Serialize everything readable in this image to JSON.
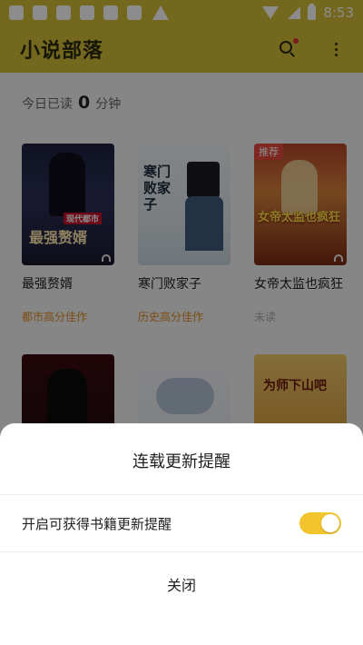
{
  "status_bar": {
    "time": "8:53"
  },
  "app": {
    "title": "小说部落"
  },
  "reading": {
    "prefix": "今日已读",
    "value": "0",
    "unit": "分钟"
  },
  "books": [
    {
      "title": "最强赘婿",
      "tag": "都市高分佳作",
      "cover_text": "最强赘婿",
      "cover_sub": "现代都市"
    },
    {
      "title": "寒门败家子",
      "tag": "历史高分佳作",
      "cover_text": "寒门败家子"
    },
    {
      "title": "女帝太监也疯狂",
      "tag": "未读",
      "badge": "推荐",
      "cover_text": "女帝太监也疯狂"
    }
  ],
  "books_row2": [
    {
      "cover_text": ""
    },
    {
      "cover_text": ""
    },
    {
      "cover_text": "为师下山吧",
      "cover_sub": "下山吧"
    }
  ],
  "sheet": {
    "title": "连载更新提醒",
    "option_label": "开启可获得书籍更新提醒",
    "option_enabled": true,
    "close_label": "关闭"
  },
  "colors": {
    "accent": "#d4be3a",
    "toggle_on": "#f3c52c",
    "tag": "#e08a1f"
  }
}
